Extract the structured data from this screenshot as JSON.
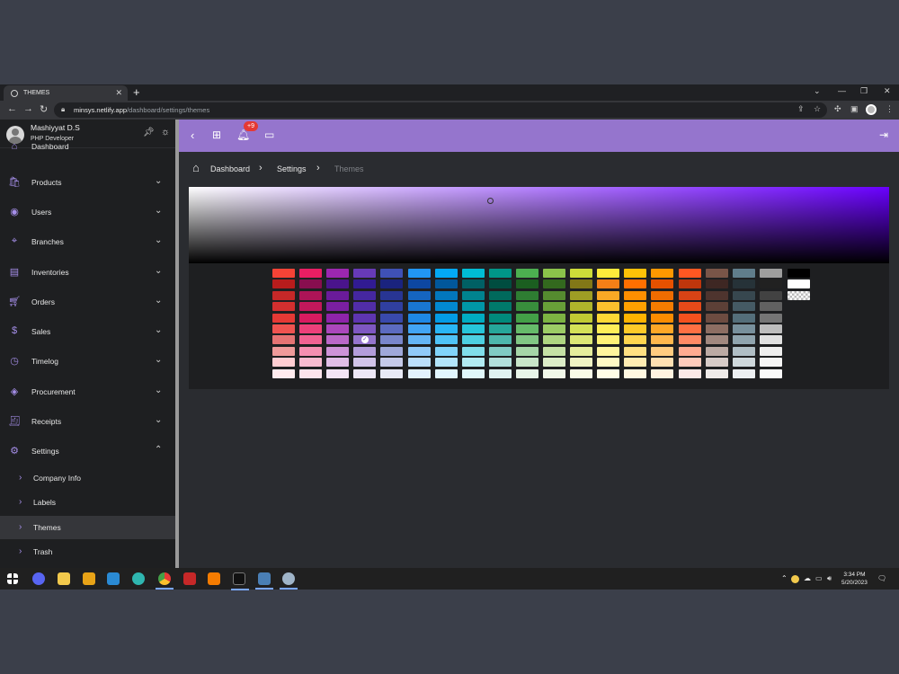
{
  "browser": {
    "tab_title": "THEMES",
    "url_host": "minsys.netlify.app",
    "url_path": "/dashboard/settings/themes"
  },
  "user": {
    "name": "Mashiyyat D.S",
    "role": "PHP Developer"
  },
  "topbar": {
    "notification_count": "+9"
  },
  "sidebar": {
    "items": [
      {
        "label": "Dashboard"
      },
      {
        "label": "Products"
      },
      {
        "label": "Users"
      },
      {
        "label": "Branches"
      },
      {
        "label": "Inventories"
      },
      {
        "label": "Orders"
      },
      {
        "label": "Sales"
      },
      {
        "label": "Timelog"
      },
      {
        "label": "Procurement"
      },
      {
        "label": "Receipts"
      },
      {
        "label": "Settings"
      }
    ],
    "sub_items": [
      {
        "label": "Company Info"
      },
      {
        "label": "Labels"
      },
      {
        "label": "Themes"
      },
      {
        "label": "Trash"
      }
    ]
  },
  "breadcrumb": {
    "home": "Dashboard",
    "level2": "Settings",
    "current": "Themes"
  },
  "palette": {
    "columns": [
      [
        "#f44336",
        "#b71c1c",
        "#c62828",
        "#d32f2f",
        "#e53935",
        "#ef5350",
        "#e57373",
        "#ef9a9a",
        "#ffcdd2",
        "#ffebee"
      ],
      [
        "#e91e63",
        "#880e4f",
        "#ad1457",
        "#c2185b",
        "#d81b60",
        "#ec407a",
        "#f06292",
        "#f48fb1",
        "#f8bbd0",
        "#fce4ec"
      ],
      [
        "#9c27b0",
        "#4a148c",
        "#6a1b9a",
        "#7b1fa2",
        "#8e24aa",
        "#ab47bc",
        "#ba68c8",
        "#ce93d8",
        "#e1bee7",
        "#f3e5f5"
      ],
      [
        "#673ab7",
        "#311b92",
        "#4527a0",
        "#512da8",
        "#5e35b1",
        "#7e57c2",
        "#9575cd",
        "#b39ddb",
        "#d1c4e9",
        "#ede7f6"
      ],
      [
        "#3f51b5",
        "#1a237e",
        "#283593",
        "#303f9f",
        "#3949ab",
        "#5c6bc0",
        "#7986cb",
        "#9fa8da",
        "#c5cae9",
        "#e8eaf6"
      ],
      [
        "#2196f3",
        "#0d47a1",
        "#1565c0",
        "#1976d2",
        "#1e88e5",
        "#42a5f5",
        "#64b5f6",
        "#90caf9",
        "#bbdefb",
        "#e3f2fd"
      ],
      [
        "#03a9f4",
        "#01579b",
        "#0277bd",
        "#0288d1",
        "#039be5",
        "#29b6f6",
        "#4fc3f7",
        "#81d4fa",
        "#b3e5fc",
        "#e1f5fe"
      ],
      [
        "#00bcd4",
        "#006064",
        "#00838f",
        "#0097a7",
        "#00acc1",
        "#26c6da",
        "#4dd0e1",
        "#80deea",
        "#b2ebf2",
        "#e0f7fa"
      ],
      [
        "#009688",
        "#004d40",
        "#00695c",
        "#00796b",
        "#00897b",
        "#26a69a",
        "#4db6ac",
        "#80cbc4",
        "#b2dfdb",
        "#e0f2f1"
      ],
      [
        "#4caf50",
        "#1b5e20",
        "#2e7d32",
        "#388e3c",
        "#43a047",
        "#66bb6a",
        "#81c784",
        "#a5d6a7",
        "#c8e6c9",
        "#e8f5e9"
      ],
      [
        "#8bc34a",
        "#33691e",
        "#558b2f",
        "#689f38",
        "#7cb342",
        "#9ccc65",
        "#aed581",
        "#c5e1a5",
        "#dcedc8",
        "#f1f8e9"
      ],
      [
        "#cddc39",
        "#827717",
        "#9e9d24",
        "#afb42b",
        "#c0ca33",
        "#d4e157",
        "#dce775",
        "#e6ee9c",
        "#f0f4c3",
        "#f9fbe7"
      ],
      [
        "#ffeb3b",
        "#f57f17",
        "#f9a825",
        "#fbc02d",
        "#fdd835",
        "#ffee58",
        "#fff176",
        "#fff59d",
        "#fff9c4",
        "#fffde7"
      ],
      [
        "#ffc107",
        "#ff6f00",
        "#ff8f00",
        "#ffa000",
        "#ffb300",
        "#ffca28",
        "#ffd54f",
        "#ffe082",
        "#ffecb3",
        "#fff8e1"
      ],
      [
        "#ff9800",
        "#e65100",
        "#ef6c00",
        "#f57c00",
        "#fb8c00",
        "#ffa726",
        "#ffb74d",
        "#ffcc80",
        "#ffe0b2",
        "#fff3e0"
      ],
      [
        "#ff5722",
        "#bf360c",
        "#d84315",
        "#e64a19",
        "#f4511e",
        "#ff7043",
        "#ff8a65",
        "#ffab91",
        "#ffccbc",
        "#fbe9e7"
      ],
      [
        "#795548",
        "#3e2723",
        "#4e342e",
        "#5d4037",
        "#6d4c41",
        "#8d6e63",
        "#a1887f",
        "#bcaaa4",
        "#d7ccc8",
        "#efebe9"
      ],
      [
        "#607d8b",
        "#263238",
        "#37474f",
        "#455a64",
        "#546e7a",
        "#78909c",
        "#90a4ae",
        "#b0bec5",
        "#cfd8dc",
        "#eceff1"
      ],
      [
        "#9e9e9e",
        "#212121",
        "#424242",
        "#616161",
        "#757575",
        "#bdbdbd",
        "#e0e0e0",
        "#eeeeee",
        "#f5f5f5",
        "#fafafa"
      ]
    ],
    "selected": {
      "column": 3,
      "row": 6
    },
    "extras": [
      "#000000",
      "#ffffff",
      "transparent"
    ]
  },
  "taskbar": {
    "time": "3:34 PM",
    "date": "5/20/2023"
  }
}
